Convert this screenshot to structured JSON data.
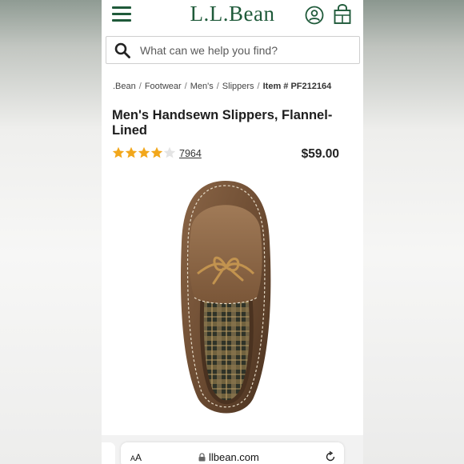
{
  "header": {
    "logo": "L.L.Bean",
    "menu_icon": "hamburger-menu-icon",
    "account_icon": "account-icon",
    "bag_icon": "shopping-bag-icon",
    "brand_color": "#1f5a3a"
  },
  "search": {
    "placeholder": "What can we help you find?",
    "icon": "search-icon"
  },
  "breadcrumb": {
    "items": [
      ".Bean",
      "Footwear",
      "Men's",
      "Slippers"
    ],
    "separator": "/",
    "item_number": "Item # PF212164"
  },
  "product": {
    "title": "Men's Handsewn Slippers, Flannel-Lined",
    "rating": 4.5,
    "rating_max": 5,
    "review_count": "7964",
    "price": "$59.00",
    "star_color": "#f2a71b"
  },
  "browser": {
    "aa_label": "AA",
    "url": "llbean.com",
    "lock_icon": "lock-icon",
    "reload_icon": "reload-icon"
  }
}
